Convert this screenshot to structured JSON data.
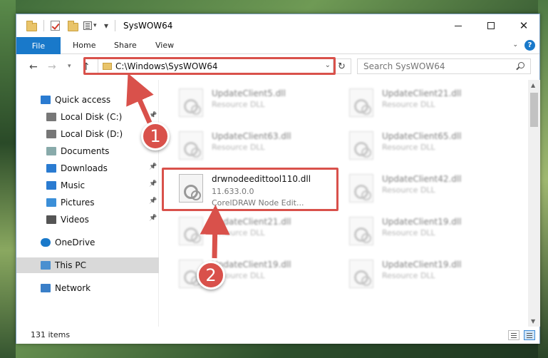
{
  "window": {
    "title": "SysWOW64"
  },
  "ribbon": {
    "file": "File",
    "tabs": [
      "Home",
      "Share",
      "View"
    ],
    "help": "?"
  },
  "address": {
    "path": "C:\\Windows\\SysWOW64"
  },
  "search": {
    "placeholder": "Search SysWOW64"
  },
  "sidebar": {
    "items": [
      {
        "label": "Quick access",
        "icon": "star-icon"
      },
      {
        "label": "Local Disk (C:)",
        "icon": "drive-icon",
        "pinned": true
      },
      {
        "label": "Local Disk (D:)",
        "icon": "drive-icon"
      },
      {
        "label": "Documents",
        "icon": "documents-icon"
      },
      {
        "label": "Downloads",
        "icon": "download-icon",
        "pinned": true
      },
      {
        "label": "Music",
        "icon": "music-icon",
        "pinned": true
      },
      {
        "label": "Pictures",
        "icon": "pictures-icon",
        "pinned": true
      },
      {
        "label": "Videos",
        "icon": "videos-icon",
        "pinned": true
      },
      {
        "label": "OneDrive",
        "icon": "cloud-icon"
      },
      {
        "label": "This PC",
        "icon": "computer-icon",
        "selected": true
      },
      {
        "label": "Network",
        "icon": "network-icon"
      }
    ]
  },
  "files": [
    {
      "name": "UpdateClient5.dll",
      "type": "Resource DLL"
    },
    {
      "name": "UpdateClient21.dll",
      "type": "Resource DLL"
    },
    {
      "name": "UpdateClient63.dll",
      "type": "Resource DLL"
    },
    {
      "name": "UpdateClient65.dll",
      "type": "Resource DLL"
    },
    {
      "name": "drwnodeedittool110.dll",
      "version": "11.633.0.0",
      "type": "CorelDRAW Node Edit..."
    },
    {
      "name": "UpdateClient42.dll",
      "type": "Resource DLL"
    },
    {
      "name": "UpdateClient21.dll",
      "type": "Resource DLL"
    },
    {
      "name": "UpdateClient19.dll",
      "type": "Resource DLL"
    },
    {
      "name": "UpdateClient19.dll",
      "type": "Resource DLL"
    },
    {
      "name": "UpdateClient19.dll",
      "type": "Resource DLL"
    }
  ],
  "status": {
    "count": "131 items"
  },
  "callouts": {
    "one": "1",
    "two": "2"
  },
  "colors": {
    "accent": "#1979ca",
    "highlight": "#d9514b"
  }
}
